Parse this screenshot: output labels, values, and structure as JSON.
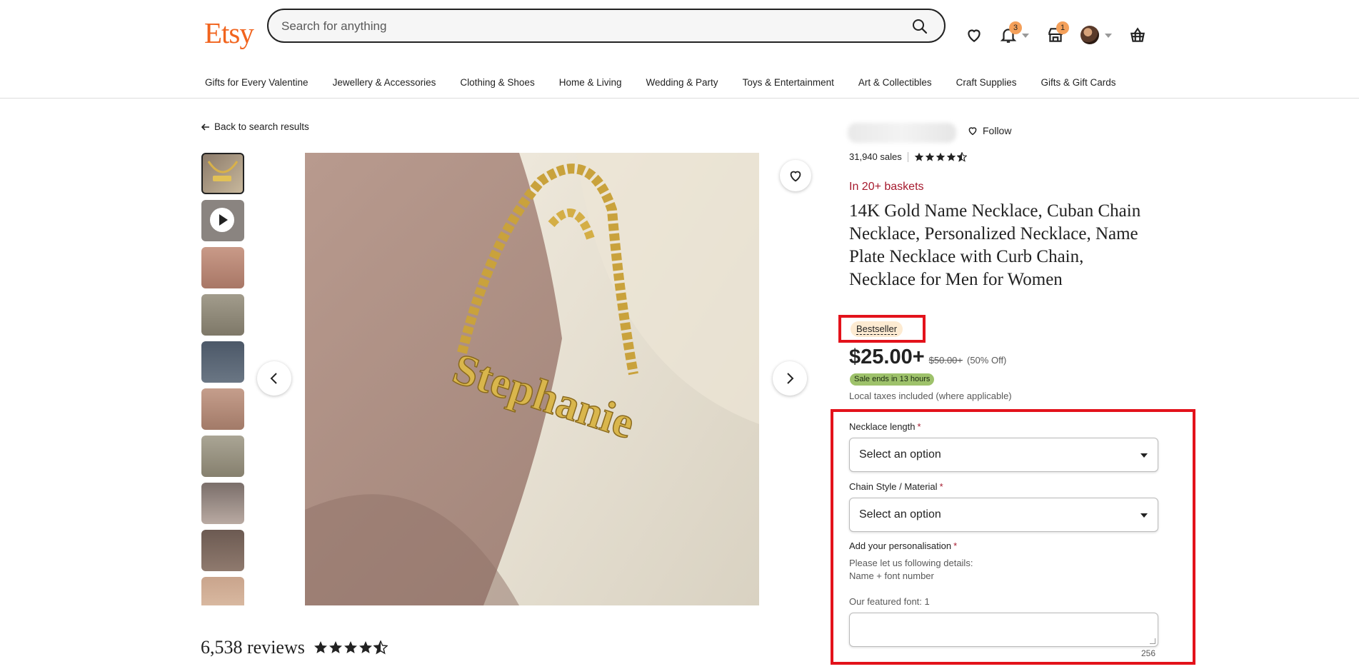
{
  "header": {
    "logo": "Etsy",
    "search_placeholder": "Search for anything",
    "notifications_count": "3",
    "shop_count": "1"
  },
  "nav": {
    "items": [
      "Gifts for Every Valentine",
      "Jewellery & Accessories",
      "Clothing & Shoes",
      "Home & Living",
      "Wedding & Party",
      "Toys & Entertainment",
      "Art & Collectibles",
      "Craft Supplies",
      "Gifts & Gift Cards"
    ]
  },
  "gallery": {
    "back_label": "Back to search results",
    "thumbnail_count": 10,
    "reviews_count_text": "6,538 reviews",
    "reviews_rating": 4.5
  },
  "listing": {
    "follow_label": "Follow",
    "sales_text": "31,940 sales",
    "shop_rating": 4.5,
    "baskets_text": "In 20+ baskets",
    "title": "14K Gold Name Necklace, Cuban Chain Necklace, Personalized Necklace, Name Plate Necklace with Curb Chain, Necklace for Men for Women",
    "bestseller_label": "Bestseller",
    "price_now": "$25.00+",
    "price_old": "$50.00+",
    "price_off": "(50% Off)",
    "sale_pill": "Sale ends in 13 hours",
    "taxes_text": "Local taxes included (where applicable)"
  },
  "options": {
    "necklace_length_label": "Necklace length",
    "necklace_length_value": "Select an option",
    "chain_style_label": "Chain Style / Material",
    "chain_style_value": "Select an option",
    "personalisation_label": "Add your personalisation",
    "personalisation_hint_1": "Please let us following details:",
    "personalisation_hint_2": "Name + font number",
    "personalisation_hint_3": "Our featured font: 1",
    "personalisation_value": "",
    "char_counter": "256",
    "required_mark": "*"
  },
  "colors": {
    "brand": "#f1641e",
    "highlight_box": "#e3121b",
    "baskets": "#a61a2e",
    "sale_pill": "#9ec26b",
    "bestseller_bg": "#fdebd2"
  }
}
